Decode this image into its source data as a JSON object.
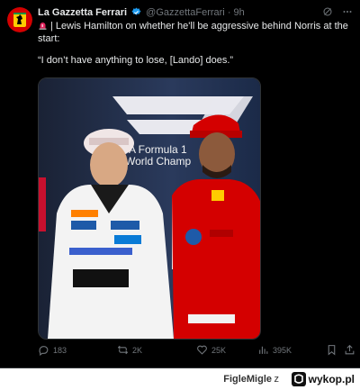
{
  "tweet": {
    "author_name": "La Gazzetta Ferrari",
    "handle": "@GazzettaFerrari",
    "separator": "·",
    "time": "9h",
    "headline_rest": "| Lewis Hamilton on whether he'll be aggressive behind Norris at the",
    "headline_cont": "start:",
    "quote": "“I don’t have anything to lose, [Lando] does.”",
    "media": {
      "backdrop_text_line1": "A Formula 1",
      "backdrop_text_line2": "World Champ",
      "logo_alt": "F1"
    }
  },
  "actions": {
    "replies": "183",
    "reposts": "2K",
    "likes": "25K",
    "views": "395K"
  },
  "footer": {
    "user": "FigleMigle",
    "symbol": "z",
    "site": "wykop.pl"
  },
  "colors": {
    "ferrari_red": "#d40000",
    "verified_blue": "#1d9bf0",
    "mclaren_orange": "#ff8000",
    "text": "#e7e9ea",
    "muted": "#71767b"
  },
  "icons": {
    "avatar": "ferrari-horse-icon",
    "verified": "verified-badge-icon",
    "grok": "grok-icon",
    "more": "more-icon",
    "siren": "siren-icon"
  }
}
